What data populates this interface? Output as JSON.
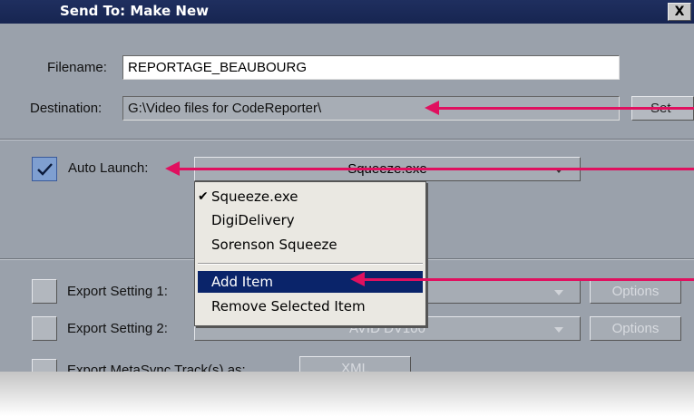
{
  "title": "Send To: Make New",
  "close_label": "X",
  "filename": {
    "label": "Filename:",
    "value": "REPORTAGE_BEAUBOURG"
  },
  "destination": {
    "label": "Destination:",
    "value": "G:\\Video files for CodeReporter\\",
    "set_label": "Set"
  },
  "auto_launch": {
    "label": "Auto Launch:",
    "checked": true,
    "selected": "Squeeze.exe"
  },
  "menu": {
    "items": [
      {
        "label": "Squeeze.exe",
        "checked": true
      },
      {
        "label": "DigiDelivery"
      },
      {
        "label": "Sorenson Squeeze"
      },
      {
        "label": "Add Item",
        "highlighted": true
      },
      {
        "label": "Remove Selected Item"
      }
    ]
  },
  "export1": {
    "label": "Export Setting 1:",
    "options_label": "Options"
  },
  "export2": {
    "label": "Export Setting 2:",
    "value": "AVID DV100",
    "options_label": "Options"
  },
  "export_meta": {
    "label": "Export MetaSync Track(s) as:",
    "value": "XML"
  },
  "colors": {
    "titlebar": "#1f2f5f",
    "dialog_bg": "#9aa1ab",
    "menu_highlight": "#0a246a",
    "annotation_arrow": "#e0105f"
  }
}
